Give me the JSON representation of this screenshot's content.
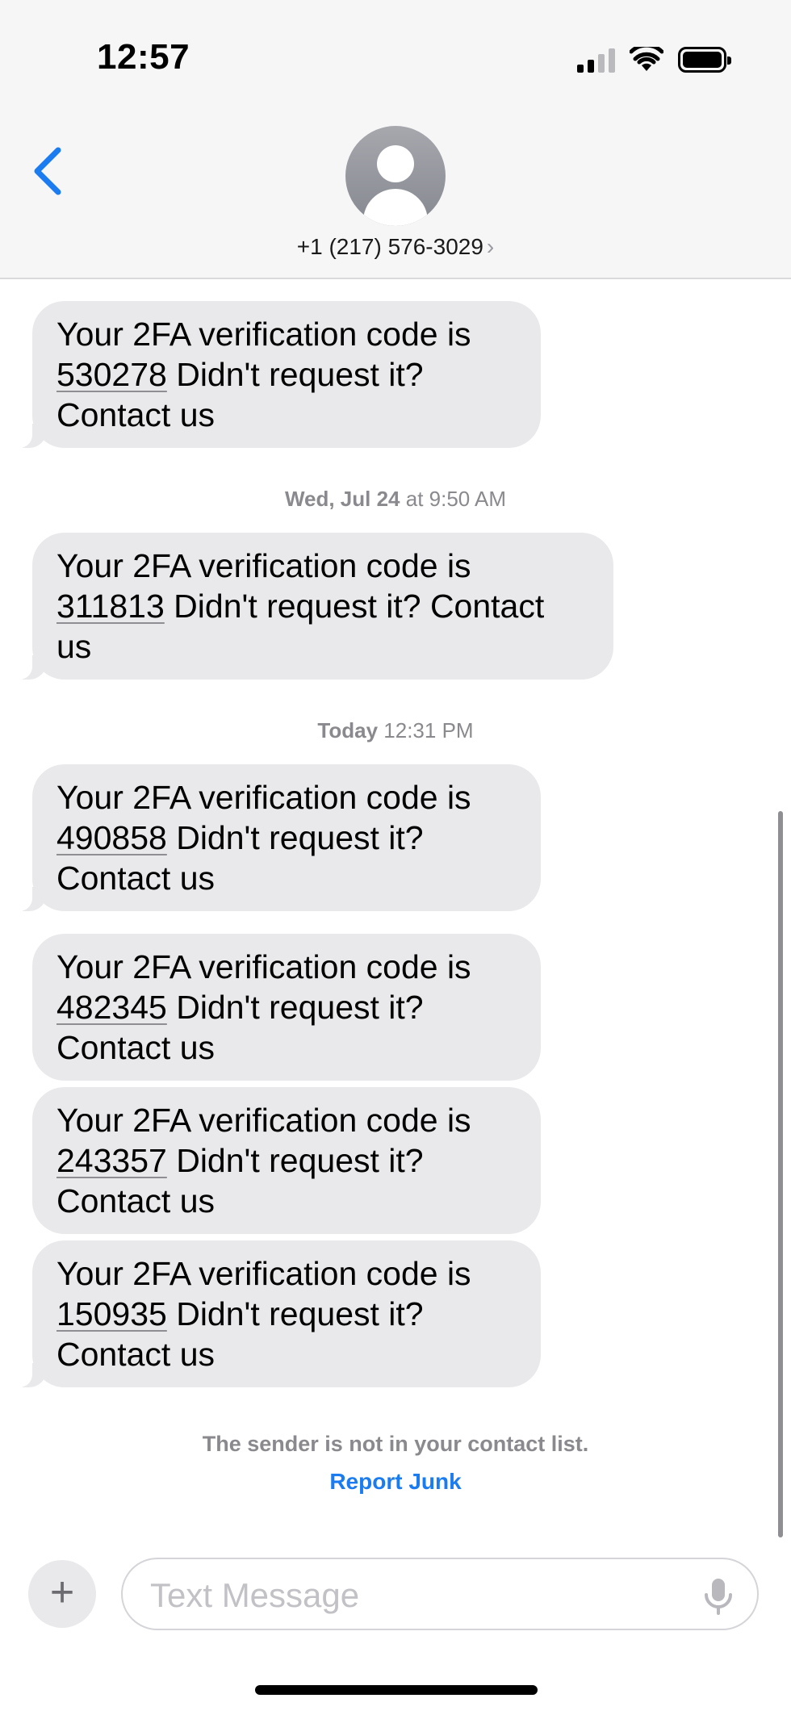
{
  "status_bar": {
    "time": "12:57"
  },
  "header": {
    "contact": "+1 (217) 576-3029",
    "contact_chevron": "›",
    "icons": [
      "back-chevron-icon",
      "contact-avatar-icon"
    ]
  },
  "messages": [
    {
      "pre": "Your 2FA verification code is",
      "code": "530278",
      "post": " Didn't request it?",
      "post2": "Contact us"
    },
    {
      "pre": "Your 2FA verification code is",
      "code": "311813",
      "post": " Didn't request it? Contact",
      "post2": "us"
    },
    {
      "pre": "Your 2FA verification code is",
      "code": "490858",
      "post": " Didn't request it?",
      "post2": "Contact us"
    },
    {
      "pre": "Your 2FA verification code is",
      "code": "482345",
      "post": " Didn't request it?",
      "post2": "Contact us"
    },
    {
      "pre": "Your 2FA verification code is",
      "code": "243357",
      "post": " Didn't request it?",
      "post2": "Contact us"
    },
    {
      "pre": "Your 2FA verification code is",
      "code": "150935",
      "post": " Didn't request it?",
      "post2": "Contact us"
    }
  ],
  "timestamps": [
    {
      "day": "Wed, Jul 24",
      "time": " at 9:50 AM"
    },
    {
      "day": "Today",
      "time": " 12:31 PM"
    }
  ],
  "notice": "The sender is not in your contact list.",
  "report_junk": "Report Junk",
  "composer": {
    "plus": "+",
    "placeholder": "Text Message",
    "icons": [
      "plus-icon",
      "microphone-icon"
    ]
  },
  "colors": {
    "bubble": "#e9e9eb",
    "accent": "#1a7cf0",
    "meta": "#8a8a8e"
  }
}
